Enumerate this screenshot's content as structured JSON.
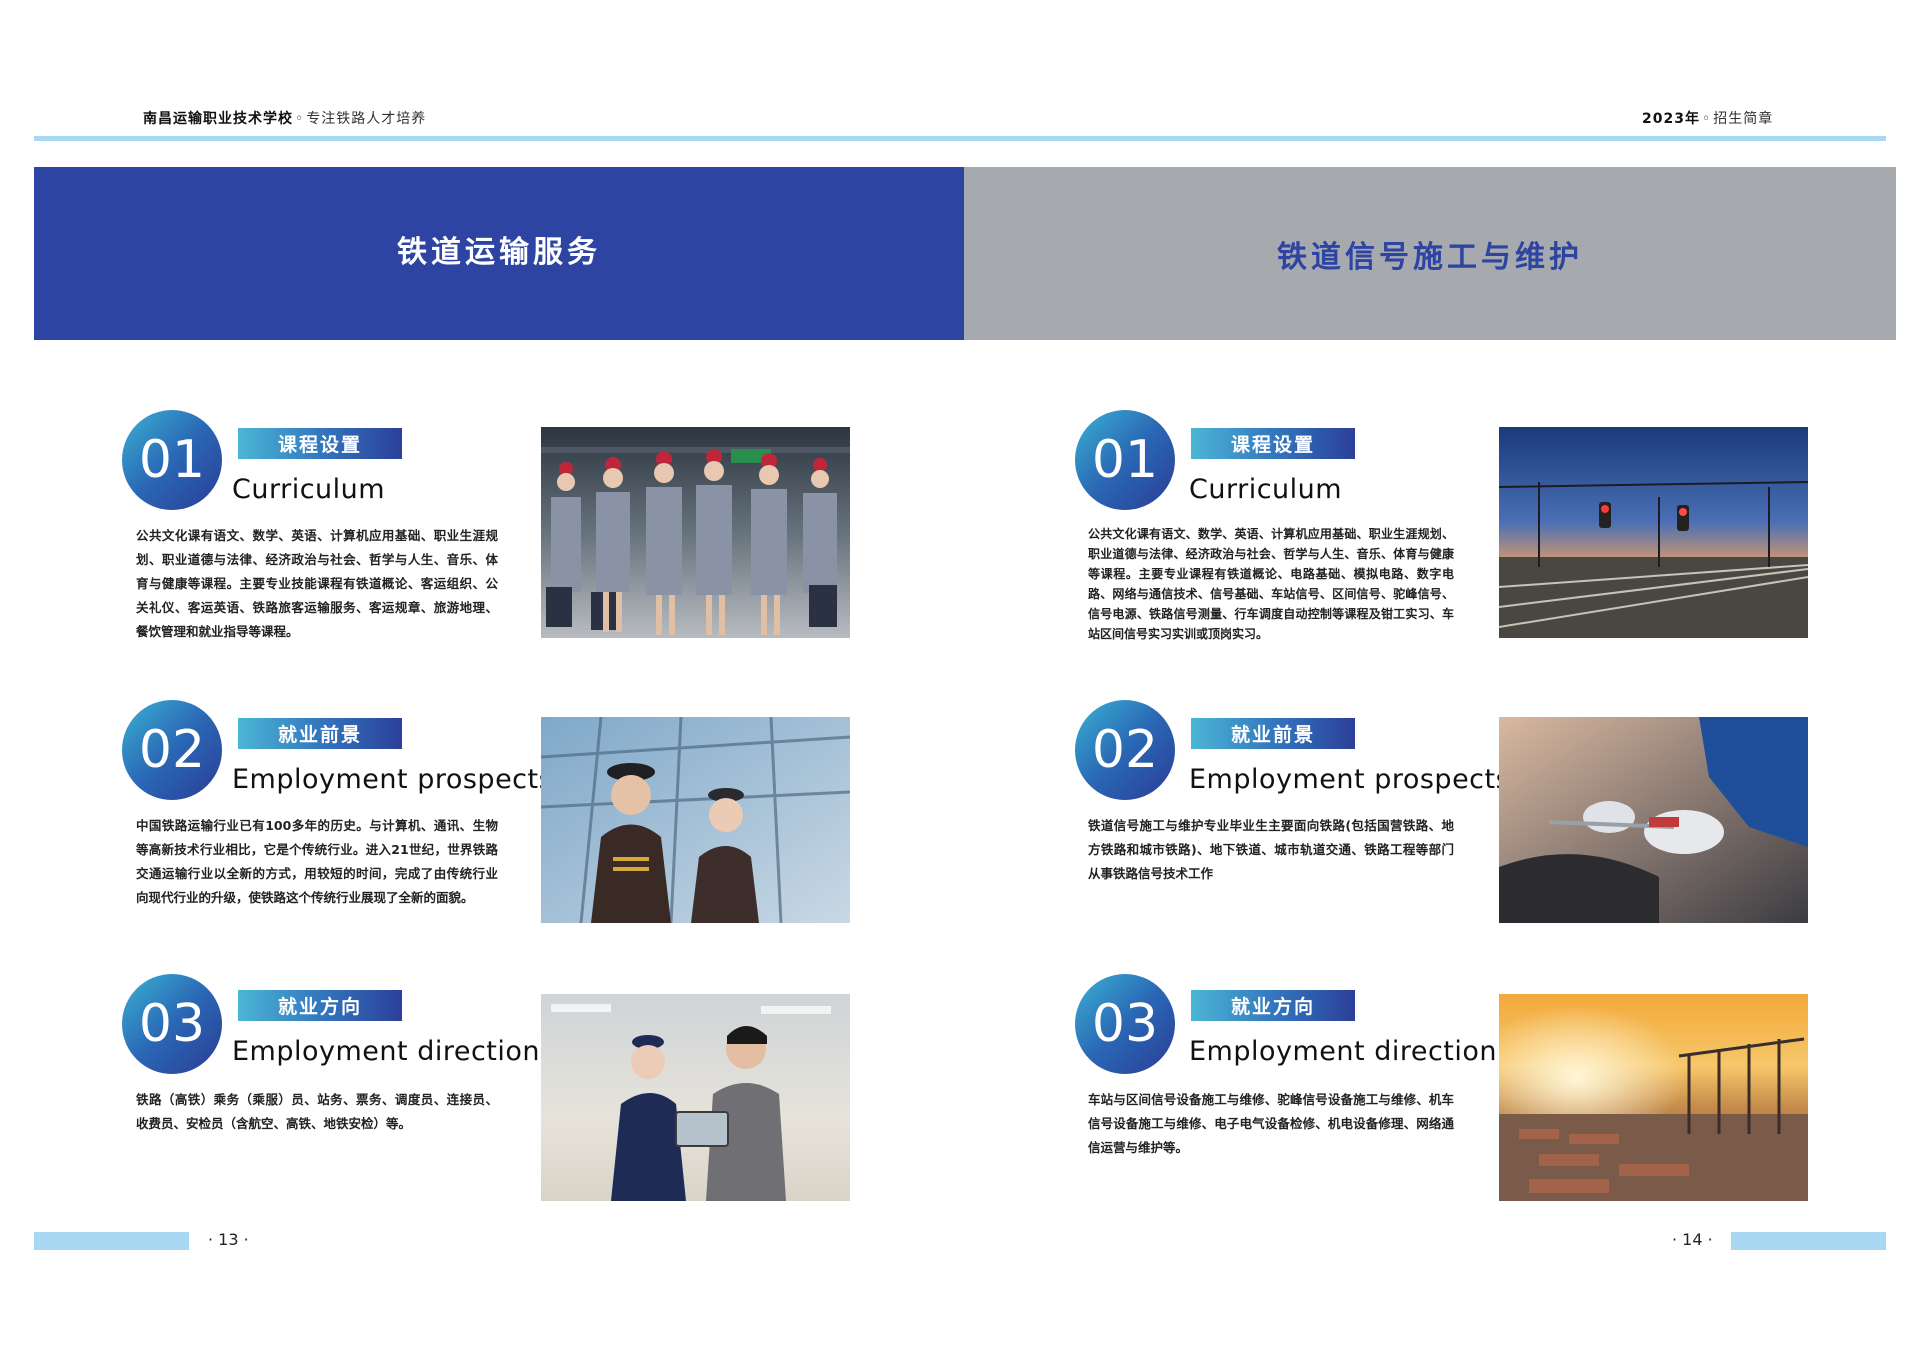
{
  "header": {
    "school": "南昌运输职业技术学校",
    "separator": "◦",
    "slogan": "专注铁路人才培养",
    "year": "2023年",
    "brochure": "招生简章"
  },
  "left": {
    "banner_title": "铁道运输服务",
    "sections": [
      {
        "num": "01",
        "tag": "课程设置",
        "en": "Curriculum",
        "text": "公共文化课有语文、数学、英语、计算机应用基础、职业生涯规划、职业道德与法律、经济政治与社会、哲学与人生、音乐、体育与健康等课程。主要专业技能课程有铁道概论、客运组织、公关礼仪、客运英语、铁路旅客运输服务、客运规章、旅游地理、餐饮管理和就业指导等课程。",
        "photo": "attendants-photo"
      },
      {
        "num": "02",
        "tag": "就业前景",
        "en": "Employment prospects",
        "text": "中国铁路运输行业已有100多年的历史。与计算机、通讯、生物等高新技术行业相比，它是个传统行业。进入21世纪，世界铁路交通运输行业以全新的方式，用较短的时间，完成了由传统行业向现代行业的升级，使铁路这个传统行业展现了全新的面貌。",
        "photo": "crew-photo"
      },
      {
        "num": "03",
        "tag": "就业方向",
        "en": "Employment direction",
        "text": "铁路（高铁）乘务（乘服）员、站务、票务、调度员、连接员、收费员、安检员（含航空、高铁、地铁安检）等。",
        "photo": "station-staff-photo"
      }
    ],
    "page_number": "· 13 ·"
  },
  "right": {
    "banner_title": "铁道信号施工与维护",
    "sections": [
      {
        "num": "01",
        "tag": "课程设置",
        "en": "Curriculum",
        "text": "公共文化课有语文、数学、英语、计算机应用基础、职业生涯规划、职业道德与法律、经济政治与社会、哲学与人生、音乐、体育与健康等课程。主要专业课程有铁道概论、电路基础、模拟电路、数字电路、网络与通信技术、信号基础、车站信号、区间信号、驼峰信号、信号电源、铁路信号测量、行车调度自动控制等课程及钳工实习、车站区间信号实习实训或顶岗实习。",
        "photo": "railway-signal-photo"
      },
      {
        "num": "02",
        "tag": "就业前景",
        "en": "Employment prospects",
        "text": "铁道信号施工与维护专业毕业生主要面向铁路(包括国营铁路、地方铁路和城市铁路)、地下铁道、城市轨道交通、铁路工程等部门从事铁路信号技术工作",
        "photo": "mechanic-photo"
      },
      {
        "num": "03",
        "tag": "就业方向",
        "en": "Employment direction",
        "text": "车站与区间信号设备施工与维修、驼峰信号设备施工与维修、机车信号设备施工与维修、电子电气设备检修、机电设备修理、网络通信运营与维护等。",
        "photo": "port-sunset-photo"
      }
    ],
    "page_number": "· 14 ·"
  },
  "colors": {
    "banner_blue": "#2e44a3",
    "banner_gray": "#a6a9ad",
    "accent_light_blue": "#a9d8f2"
  }
}
